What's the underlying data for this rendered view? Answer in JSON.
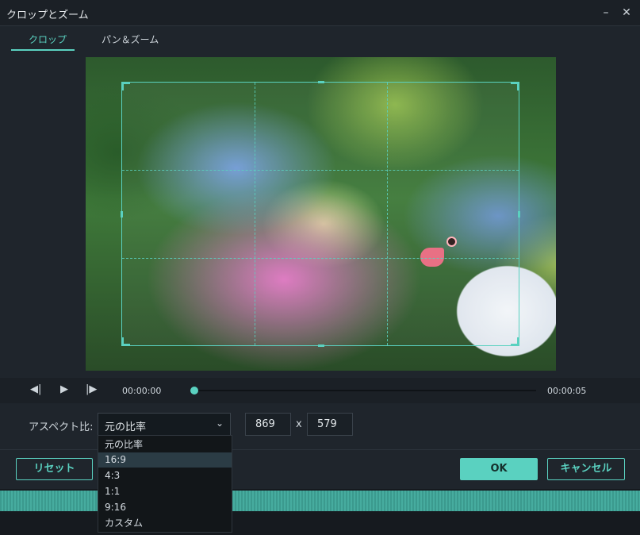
{
  "window": {
    "title": "クロップとズーム",
    "minimize_icon": "–",
    "close_icon": "✕"
  },
  "tabs": [
    {
      "label": "クロップ",
      "active": true
    },
    {
      "label": "パン＆ズーム",
      "active": false
    }
  ],
  "player": {
    "prev_frame_icon": "◀|",
    "play_icon": "▶",
    "next_frame_icon": "|▶",
    "current_time": "00:00:00",
    "end_time": "00:00:05",
    "progress": 0
  },
  "aspect": {
    "label": "アスペクト比:",
    "selected": "元の比率",
    "width": "869",
    "separator": "x",
    "height": "579",
    "options": [
      "元の比率",
      "16:9",
      "4:3",
      "1:1",
      "9:16",
      "カスタム"
    ],
    "highlighted_index": 1
  },
  "buttons": {
    "reset": "リセット",
    "ok": "OK",
    "cancel": "キャンセル"
  },
  "colors": {
    "accent": "#5ad1c0",
    "background": "#1f252c"
  }
}
